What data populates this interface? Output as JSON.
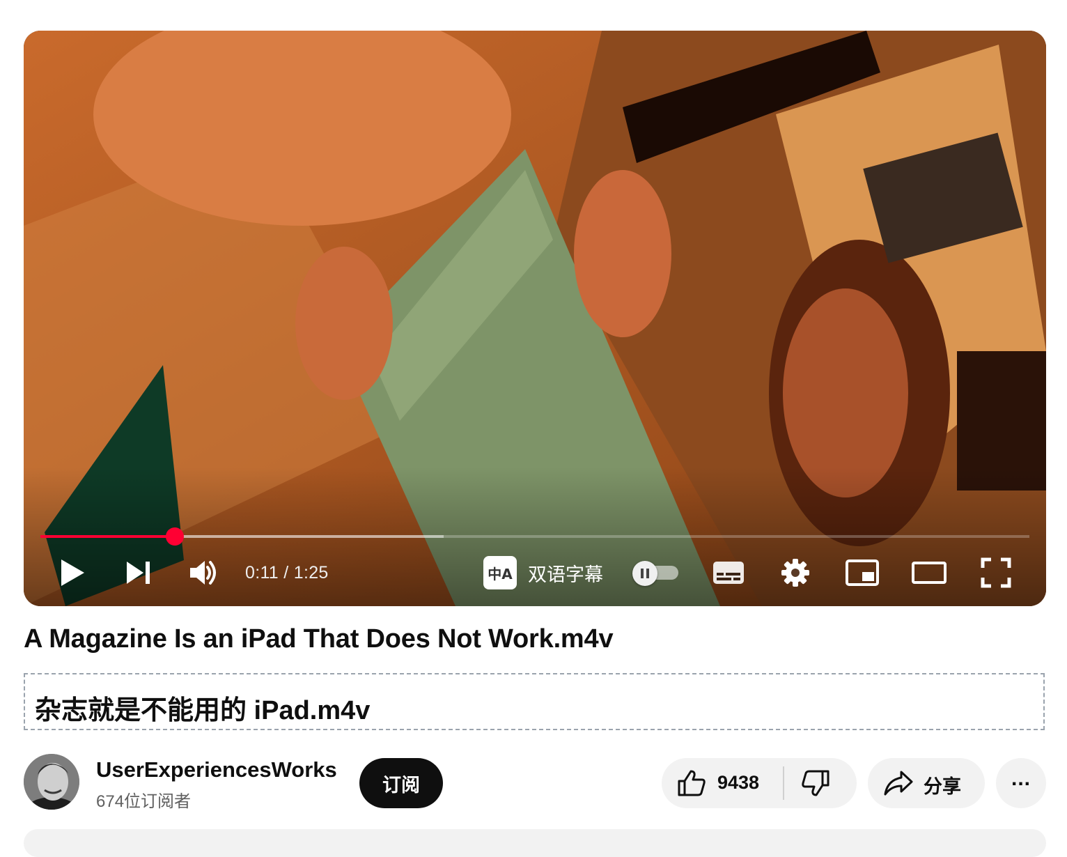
{
  "player": {
    "time_current": "0:11",
    "time_separator": " / ",
    "time_total": "1:25",
    "progress_played_fraction": 0.136,
    "progress_buffered_fraction": 0.408,
    "dual_subtitle_icon_text": "中A",
    "dual_subtitle_label": "双语字幕",
    "autoplay_on": false,
    "icons": {
      "play": "play-icon",
      "next": "next-icon",
      "volume": "volume-icon",
      "autoplay": "autoplay-toggle",
      "subtitles": "subtitles-icon",
      "settings": "gear-icon",
      "miniplayer": "miniplayer-icon",
      "theater": "theater-mode-icon",
      "fullscreen": "fullscreen-icon"
    },
    "accent_color": "#ff0033"
  },
  "video": {
    "title": "A Magazine Is an iPad That Does Not Work.m4v",
    "translated_title": "杂志就是不能用的 iPad.m4v"
  },
  "channel": {
    "name": "UserExperiencesWorks",
    "subscribers": "674位订阅者",
    "subscribe_label": "订阅"
  },
  "actions": {
    "like_count": "9438",
    "share_label": "分享",
    "more_label": "..."
  }
}
